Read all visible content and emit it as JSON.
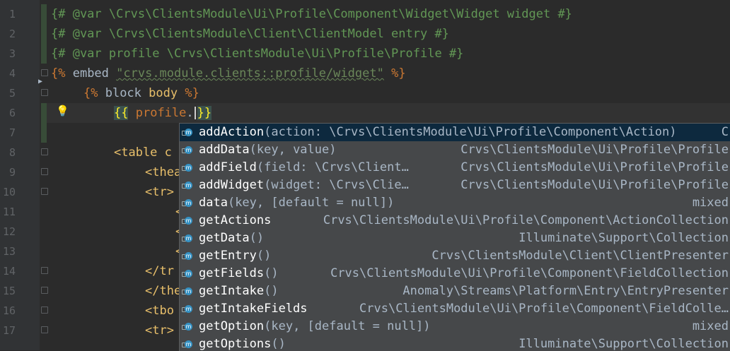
{
  "editor": {
    "line_numbers": [
      "1",
      "2",
      "3",
      "4",
      "5",
      "6",
      "7",
      "8",
      "9",
      "10",
      "11",
      "12",
      "13",
      "14",
      "15",
      "16",
      "17"
    ],
    "lines": {
      "l1": "{# @var \\Crvs\\ClientsModule\\Ui\\Profile\\Component\\Widget\\Widget widget #}",
      "l2": "{# @var \\Crvs\\ClientsModule\\Client\\ClientModel entry #}",
      "l3": "{# @var profile \\Crvs\\ClientsModule\\Ui\\Profile\\Profile #}",
      "l4_open": "{%",
      "l4_kw": " embed ",
      "l4_str": "\"crvs.module.clients::profile/widget\"",
      "l4_close": " %}",
      "l5_open": "{%",
      "l5_kw": " block ",
      "l5_id": "body",
      "l5_close": " %}",
      "l6_open": "{{",
      "l6_var": "profile",
      "l6_dot": ".",
      "l6_close": "}}",
      "l8": "<table c",
      "l9": "<thea",
      "l10": "<tr>",
      "l11": "<",
      "l12": "<",
      "l13": "<",
      "l14": "</tr",
      "l15": "</the",
      "l16": "<tbo",
      "l17": "<tr>"
    }
  },
  "completion": {
    "items": [
      {
        "name": "addAction",
        "params": "(action: \\Crvs\\ClientsModule\\Ui\\Profile\\Component\\Action)",
        "type": "C"
      },
      {
        "name": "addData",
        "params": "(key, value)",
        "type": "Crvs\\ClientsModule\\Ui\\Profile\\Profile"
      },
      {
        "name": "addField",
        "params": "(field: \\Crvs\\Client…",
        "type": "Crvs\\ClientsModule\\Ui\\Profile\\Profile"
      },
      {
        "name": "addWidget",
        "params": "(widget: \\Crvs\\Clie…",
        "type": "Crvs\\ClientsModule\\Ui\\Profile\\Profile"
      },
      {
        "name": "data",
        "params": "(key, [default = null])",
        "type": "mixed"
      },
      {
        "name": "getActions",
        "params": "",
        "type": "Crvs\\ClientsModule\\Ui\\Profile\\Component\\ActionCollection"
      },
      {
        "name": "getData",
        "params": "()",
        "type": "Illuminate\\Support\\Collection"
      },
      {
        "name": "getEntry",
        "params": "()",
        "type": "Crvs\\ClientsModule\\Client\\ClientPresenter"
      },
      {
        "name": "getFields",
        "params": "()",
        "type": "Crvs\\ClientsModule\\Ui\\Profile\\Component\\FieldCollection"
      },
      {
        "name": "getIntake",
        "params": "()",
        "type": "Anomaly\\Streams\\Platform\\Entry\\EntryPresenter"
      },
      {
        "name": "getIntakeFields",
        "params": "",
        "type": "Crvs\\ClientsModule\\Ui\\Profile\\Component\\FieldColle…"
      },
      {
        "name": "getOption",
        "params": "(key, [default = null])",
        "type": "mixed"
      },
      {
        "name": "getOptions",
        "params": "()",
        "type": "Illuminate\\Support\\Collection"
      }
    ]
  }
}
